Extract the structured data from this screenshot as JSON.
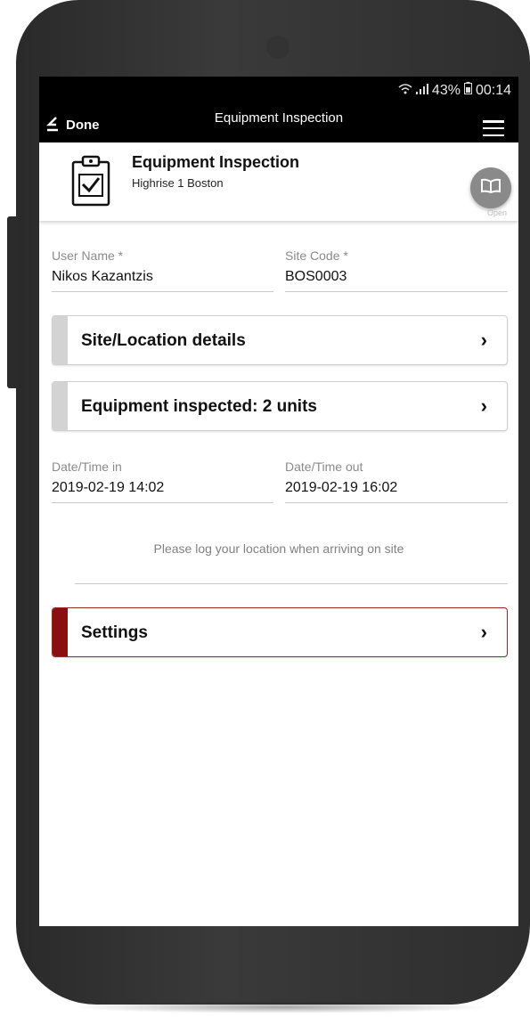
{
  "status_bar": {
    "battery": "43%",
    "time": "00:14"
  },
  "top_bar": {
    "done_label": "Done",
    "title": "Equipment Inspection"
  },
  "header": {
    "form_title": "Equipment Inspection",
    "form_subtitle": "Highrise 1 Boston",
    "open_label": "Open"
  },
  "fields": {
    "user_name": {
      "label": "User Name *",
      "value": "Nikos Kazantzis"
    },
    "site_code": {
      "label": "Site Code *",
      "value": "BOS0003"
    },
    "date_in": {
      "label": "Date/Time in",
      "value": "2019-02-19 14:02"
    },
    "date_out": {
      "label": "Date/Time out",
      "value": "2019-02-19 16:02"
    }
  },
  "sections": {
    "site_location": "Site/Location details",
    "equipment": "Equipment inspected: 2 units",
    "settings": "Settings",
    "chevron": "›"
  },
  "location_hint": "Please log your location when arriving on site",
  "colors": {
    "settings_accent": "#8b0f0f",
    "topbar": "#000000"
  }
}
